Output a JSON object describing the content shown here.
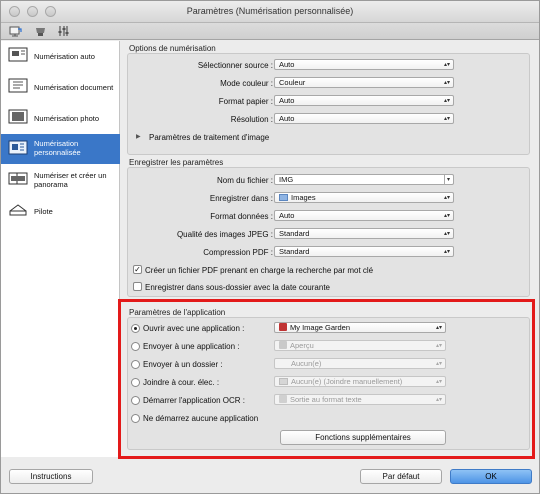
{
  "window": {
    "title": "Paramètres (Numérisation personnalisée)"
  },
  "toolbar": {
    "icons": [
      "scan-from-computer-icon",
      "scan-from-panel-icon",
      "general-settings-icon"
    ]
  },
  "sidebar": {
    "items": [
      {
        "label": "Numérisation auto",
        "icon": "auto-scan-icon"
      },
      {
        "label": "Numérisation document",
        "icon": "document-scan-icon"
      },
      {
        "label": "Numérisation photo",
        "icon": "photo-scan-icon"
      },
      {
        "label": "Numérisation personnalisée",
        "icon": "custom-scan-icon",
        "selected": true
      },
      {
        "label": "Numériser et créer un panorama",
        "icon": "panorama-scan-icon"
      },
      {
        "label": "Pilote",
        "icon": "driver-icon"
      }
    ]
  },
  "scan_options": {
    "title": "Options de numérisation",
    "source_label": "Sélectionner source :",
    "source_value": "Auto",
    "color_label": "Mode couleur :",
    "color_value": "Couleur",
    "paper_label": "Format papier :",
    "paper_value": "Auto",
    "resolution_label": "Résolution :",
    "resolution_value": "Auto",
    "image_processing_label": "Paramètres de traitement d'image"
  },
  "save_settings": {
    "title": "Enregistrer les paramètres",
    "filename_label": "Nom du fichier :",
    "filename_value": "IMG",
    "save_in_label": "Enregistrer dans :",
    "save_in_value": "Images",
    "format_label": "Format données :",
    "format_value": "Auto",
    "jpeg_label": "Qualité des images JPEG :",
    "jpeg_value": "Standard",
    "pdf_label": "Compression PDF :",
    "pdf_value": "Standard",
    "searchable_pdf_label": "Créer un fichier PDF prenant en charge la recherche par mot clé",
    "searchable_pdf_checked": true,
    "subfolder_label": "Enregistrer dans sous-dossier avec la date courante",
    "subfolder_checked": false
  },
  "app_settings": {
    "title": "Paramètres de l'application",
    "open_app_label": "Ouvrir avec une application :",
    "open_app_value": "My Image Garden",
    "send_app_label": "Envoyer à une application :",
    "send_app_value": "Aperçu",
    "send_folder_label": "Envoyer à un dossier :",
    "send_folder_value": "Aucun(e)",
    "email_label": "Joindre à cour. élec. :",
    "email_value": "Aucun(e) (Joindre manuellement)",
    "ocr_label": "Démarrer l'application OCR :",
    "ocr_value": "Sortie au format texte",
    "no_app_label": "Ne démarrez aucune application",
    "more_functions_label": "Fonctions supplémentaires"
  },
  "footer": {
    "instructions_label": "Instructions",
    "defaults_label": "Par défaut",
    "ok_label": "OK"
  },
  "colors": {
    "selection": "#3a77c8",
    "highlight": "#e31a1a",
    "ok_button": "#4e94e6"
  }
}
